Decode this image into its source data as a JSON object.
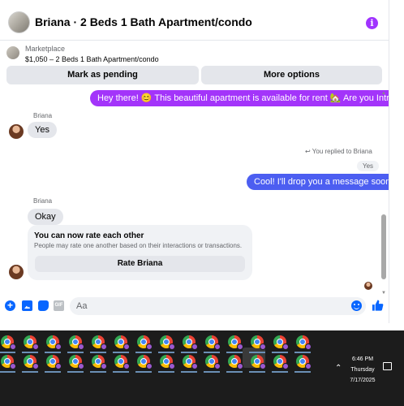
{
  "header": {
    "title": "Briana · 2 Beds 1 Bath Apartment/condo",
    "info_glyph": "i"
  },
  "listing": {
    "source": "Marketplace",
    "price_line": "$1,050 – 2 Beds 1 Bath Apartment/condo",
    "mark_pending_label": "Mark as pending",
    "more_options_label": "More options"
  },
  "messages": {
    "msg1": "Hey there! 😊 This beautiful apartment is available for rent 🏡 Are you Intrested?",
    "sender1": "Briana",
    "reply1": "Yes",
    "replied_note": "You replied to Briana",
    "quoted": "Yes",
    "msg2": "Cool! I'll drop you a message soon.",
    "sender2": "Briana",
    "reply2": "Okay",
    "rate_title": "You can now rate each other",
    "rate_subtitle": "People may rate one another based on their interactions or transactions.",
    "rate_button": "Rate Briana"
  },
  "composer": {
    "placeholder": "Aa",
    "gif_label": "GIF"
  },
  "taskbar": {
    "time": "6:46 PM",
    "day": "Thursday",
    "date": "7/17/2025"
  },
  "colors": {
    "purple_bubble": "#a334fa",
    "blue_bubble": "#4c5ef1",
    "brand_blue": "#0866ff"
  }
}
